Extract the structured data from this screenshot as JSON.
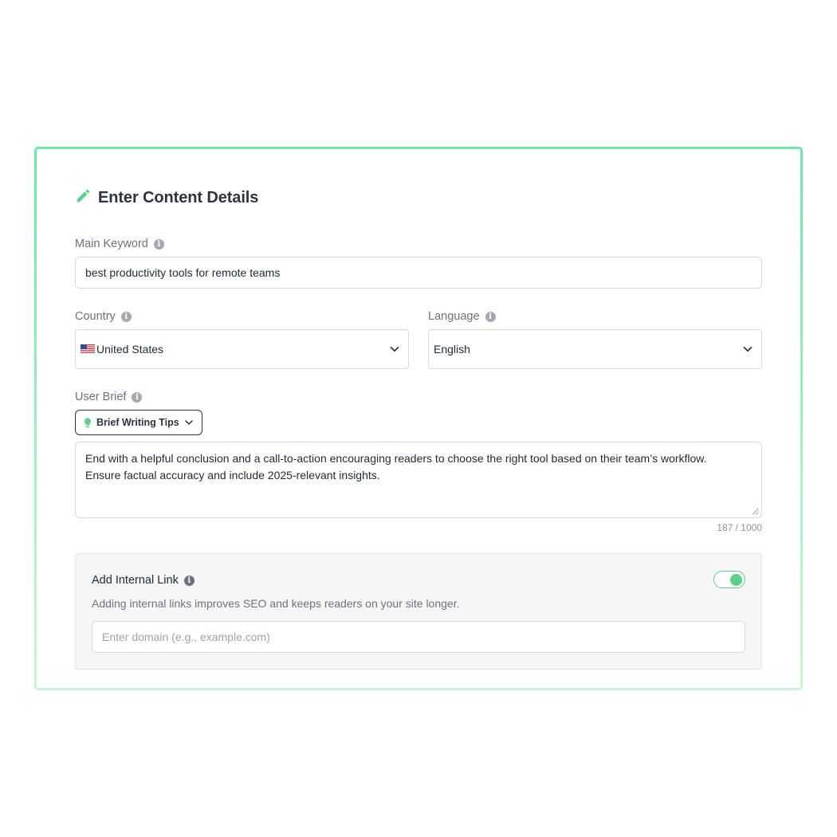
{
  "form": {
    "title": "Enter Content Details",
    "main_keyword": {
      "label": "Main Keyword",
      "value": "best productivity tools for remote teams"
    },
    "country": {
      "label": "Country",
      "selected": "United States",
      "flag_icon": "us-flag-icon"
    },
    "language": {
      "label": "Language",
      "selected": "English"
    },
    "user_brief": {
      "label": "User Brief",
      "tips_button": "Brief Writing Tips",
      "text_line_1": "End with a helpful conclusion and a call-to-action encouraging readers to choose the right tool based on their team’s workflow.",
      "text_line_2": "Ensure factual accuracy and include 2025-relevant insights.",
      "counter": "187 / 1000"
    },
    "internal_link": {
      "title": "Add Internal Link",
      "description": "Adding internal links improves SEO and keeps readers on your site longer.",
      "toggle_on": true,
      "domain_placeholder": "Enter domain (e.g., example.com)"
    }
  },
  "colors": {
    "accent": "#5fcf8b",
    "card_border_top": "#6ee7a8",
    "card_border_bottom": "#c9f7d6"
  }
}
